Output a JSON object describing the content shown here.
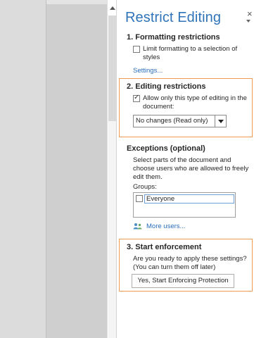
{
  "pane": {
    "title": "Restrict Editing",
    "close_glyph": "×"
  },
  "formatting": {
    "heading": "1. Formatting restrictions",
    "checkbox_label_line1": "Limit formatting to a selection of",
    "checkbox_label_line2": "styles",
    "checked": false,
    "settings_link": "Settings..."
  },
  "editing": {
    "heading": "2. Editing restrictions",
    "checkbox_label_line1": "Allow only this type of editing in the",
    "checkbox_label_line2": "document:",
    "checked": true,
    "selected_option": "No changes (Read only)"
  },
  "exceptions": {
    "heading": "Exceptions (optional)",
    "description_line1": "Select parts of the document and",
    "description_line2": "choose users who are allowed to freely",
    "description_line3": "edit them.",
    "groups_label": "Groups:",
    "groups": [
      {
        "name": "Everyone",
        "checked": false
      }
    ],
    "more_users_link": "More users..."
  },
  "enforcement": {
    "heading": "3. Start enforcement",
    "question_line1": "Are you ready to apply these settings?",
    "question_line2": "(You can turn them off later)",
    "button_label": "Yes, Start Enforcing Protection"
  },
  "colors": {
    "title_blue": "#2f74b8",
    "link_blue": "#2a6ebb",
    "highlight_orange": "#ef9a52"
  }
}
